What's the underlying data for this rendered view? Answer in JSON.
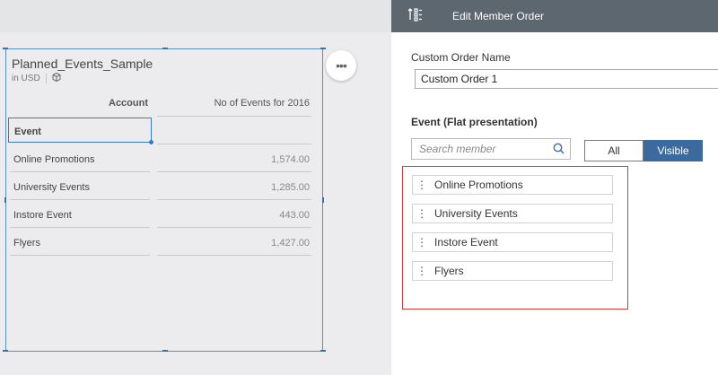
{
  "widget": {
    "title": "Planned_Events_Sample",
    "currency": "in USD",
    "header_account": "Account",
    "header_value": "No of Events for 2016",
    "dimension_label": "Event",
    "rows": [
      {
        "label": "Online Promotions",
        "value": "1,574.00"
      },
      {
        "label": "University Events",
        "value": "1,285.00"
      },
      {
        "label": "Instore Event",
        "value": "443.00"
      },
      {
        "label": "Flyers",
        "value": "1,427.00"
      }
    ],
    "more_icon": "•••"
  },
  "panel": {
    "title": "Edit Member Order",
    "name_label": "Custom Order Name",
    "name_value": "Custom Order 1",
    "section_title": "Event (Flat presentation)",
    "search_placeholder": "Search member",
    "toggle_all": "All",
    "toggle_visible": "Visible",
    "members": [
      "Online Promotions",
      "University Events",
      "Instore Event",
      "Flyers"
    ],
    "grip_glyph": "⋮"
  },
  "colors": {
    "header_bg": "#5c6770",
    "accent": "#3d6a9e",
    "highlight_border": "#d33a3a",
    "selection": "#3b79bf"
  }
}
